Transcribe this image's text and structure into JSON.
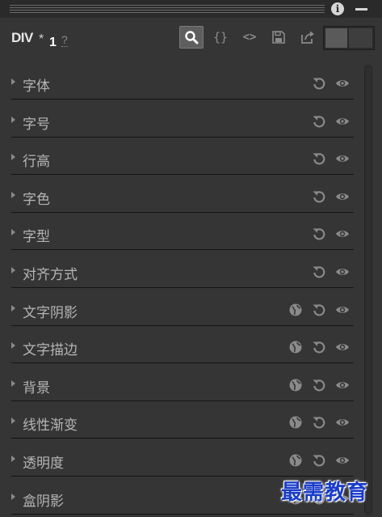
{
  "header": {
    "info_icon": "info-icon",
    "minimize_icon": "minimize-icon"
  },
  "toolbar": {
    "element_name": "DIV",
    "asterisk": "*",
    "count": "1",
    "help": "?",
    "braces_label": "{}",
    "code_label": "<>",
    "search_icon": "search-icon",
    "save_icon": "save-icon",
    "export_icon": "export-icon"
  },
  "sections": [
    {
      "label": "字体",
      "globe": false
    },
    {
      "label": "字号",
      "globe": false
    },
    {
      "label": "行高",
      "globe": false
    },
    {
      "label": "字色",
      "globe": false
    },
    {
      "label": "字型",
      "globe": false
    },
    {
      "label": "对齐方式",
      "globe": false
    },
    {
      "label": "文字阴影",
      "globe": true
    },
    {
      "label": "文字描边",
      "globe": true
    },
    {
      "label": "背景",
      "globe": true
    },
    {
      "label": "线性渐变",
      "globe": true
    },
    {
      "label": "透明度",
      "globe": true
    },
    {
      "label": "盒阴影",
      "globe": true
    }
  ],
  "watermark": "最需教育",
  "colors": {
    "panel_bg": "#353535",
    "text": "#b5b5b5",
    "icon": "#8a8a8a",
    "watermark": "#1a3cc8"
  }
}
